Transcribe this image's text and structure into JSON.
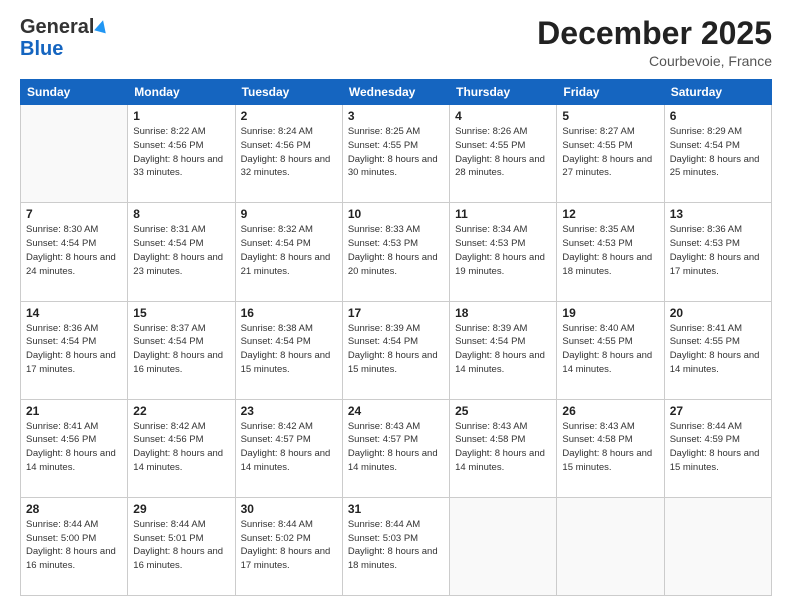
{
  "logo": {
    "general": "General",
    "blue": "Blue"
  },
  "title": "December 2025",
  "subtitle": "Courbevoie, France",
  "days_header": [
    "Sunday",
    "Monday",
    "Tuesday",
    "Wednesday",
    "Thursday",
    "Friday",
    "Saturday"
  ],
  "weeks": [
    [
      {
        "num": "",
        "sunrise": "",
        "sunset": "",
        "daylight": ""
      },
      {
        "num": "1",
        "sunrise": "Sunrise: 8:22 AM",
        "sunset": "Sunset: 4:56 PM",
        "daylight": "Daylight: 8 hours and 33 minutes."
      },
      {
        "num": "2",
        "sunrise": "Sunrise: 8:24 AM",
        "sunset": "Sunset: 4:56 PM",
        "daylight": "Daylight: 8 hours and 32 minutes."
      },
      {
        "num": "3",
        "sunrise": "Sunrise: 8:25 AM",
        "sunset": "Sunset: 4:55 PM",
        "daylight": "Daylight: 8 hours and 30 minutes."
      },
      {
        "num": "4",
        "sunrise": "Sunrise: 8:26 AM",
        "sunset": "Sunset: 4:55 PM",
        "daylight": "Daylight: 8 hours and 28 minutes."
      },
      {
        "num": "5",
        "sunrise": "Sunrise: 8:27 AM",
        "sunset": "Sunset: 4:55 PM",
        "daylight": "Daylight: 8 hours and 27 minutes."
      },
      {
        "num": "6",
        "sunrise": "Sunrise: 8:29 AM",
        "sunset": "Sunset: 4:54 PM",
        "daylight": "Daylight: 8 hours and 25 minutes."
      }
    ],
    [
      {
        "num": "7",
        "sunrise": "Sunrise: 8:30 AM",
        "sunset": "Sunset: 4:54 PM",
        "daylight": "Daylight: 8 hours and 24 minutes."
      },
      {
        "num": "8",
        "sunrise": "Sunrise: 8:31 AM",
        "sunset": "Sunset: 4:54 PM",
        "daylight": "Daylight: 8 hours and 23 minutes."
      },
      {
        "num": "9",
        "sunrise": "Sunrise: 8:32 AM",
        "sunset": "Sunset: 4:54 PM",
        "daylight": "Daylight: 8 hours and 21 minutes."
      },
      {
        "num": "10",
        "sunrise": "Sunrise: 8:33 AM",
        "sunset": "Sunset: 4:53 PM",
        "daylight": "Daylight: 8 hours and 20 minutes."
      },
      {
        "num": "11",
        "sunrise": "Sunrise: 8:34 AM",
        "sunset": "Sunset: 4:53 PM",
        "daylight": "Daylight: 8 hours and 19 minutes."
      },
      {
        "num": "12",
        "sunrise": "Sunrise: 8:35 AM",
        "sunset": "Sunset: 4:53 PM",
        "daylight": "Daylight: 8 hours and 18 minutes."
      },
      {
        "num": "13",
        "sunrise": "Sunrise: 8:36 AM",
        "sunset": "Sunset: 4:53 PM",
        "daylight": "Daylight: 8 hours and 17 minutes."
      }
    ],
    [
      {
        "num": "14",
        "sunrise": "Sunrise: 8:36 AM",
        "sunset": "Sunset: 4:54 PM",
        "daylight": "Daylight: 8 hours and 17 minutes."
      },
      {
        "num": "15",
        "sunrise": "Sunrise: 8:37 AM",
        "sunset": "Sunset: 4:54 PM",
        "daylight": "Daylight: 8 hours and 16 minutes."
      },
      {
        "num": "16",
        "sunrise": "Sunrise: 8:38 AM",
        "sunset": "Sunset: 4:54 PM",
        "daylight": "Daylight: 8 hours and 15 minutes."
      },
      {
        "num": "17",
        "sunrise": "Sunrise: 8:39 AM",
        "sunset": "Sunset: 4:54 PM",
        "daylight": "Daylight: 8 hours and 15 minutes."
      },
      {
        "num": "18",
        "sunrise": "Sunrise: 8:39 AM",
        "sunset": "Sunset: 4:54 PM",
        "daylight": "Daylight: 8 hours and 14 minutes."
      },
      {
        "num": "19",
        "sunrise": "Sunrise: 8:40 AM",
        "sunset": "Sunset: 4:55 PM",
        "daylight": "Daylight: 8 hours and 14 minutes."
      },
      {
        "num": "20",
        "sunrise": "Sunrise: 8:41 AM",
        "sunset": "Sunset: 4:55 PM",
        "daylight": "Daylight: 8 hours and 14 minutes."
      }
    ],
    [
      {
        "num": "21",
        "sunrise": "Sunrise: 8:41 AM",
        "sunset": "Sunset: 4:56 PM",
        "daylight": "Daylight: 8 hours and 14 minutes."
      },
      {
        "num": "22",
        "sunrise": "Sunrise: 8:42 AM",
        "sunset": "Sunset: 4:56 PM",
        "daylight": "Daylight: 8 hours and 14 minutes."
      },
      {
        "num": "23",
        "sunrise": "Sunrise: 8:42 AM",
        "sunset": "Sunset: 4:57 PM",
        "daylight": "Daylight: 8 hours and 14 minutes."
      },
      {
        "num": "24",
        "sunrise": "Sunrise: 8:43 AM",
        "sunset": "Sunset: 4:57 PM",
        "daylight": "Daylight: 8 hours and 14 minutes."
      },
      {
        "num": "25",
        "sunrise": "Sunrise: 8:43 AM",
        "sunset": "Sunset: 4:58 PM",
        "daylight": "Daylight: 8 hours and 14 minutes."
      },
      {
        "num": "26",
        "sunrise": "Sunrise: 8:43 AM",
        "sunset": "Sunset: 4:58 PM",
        "daylight": "Daylight: 8 hours and 15 minutes."
      },
      {
        "num": "27",
        "sunrise": "Sunrise: 8:44 AM",
        "sunset": "Sunset: 4:59 PM",
        "daylight": "Daylight: 8 hours and 15 minutes."
      }
    ],
    [
      {
        "num": "28",
        "sunrise": "Sunrise: 8:44 AM",
        "sunset": "Sunset: 5:00 PM",
        "daylight": "Daylight: 8 hours and 16 minutes."
      },
      {
        "num": "29",
        "sunrise": "Sunrise: 8:44 AM",
        "sunset": "Sunset: 5:01 PM",
        "daylight": "Daylight: 8 hours and 16 minutes."
      },
      {
        "num": "30",
        "sunrise": "Sunrise: 8:44 AM",
        "sunset": "Sunset: 5:02 PM",
        "daylight": "Daylight: 8 hours and 17 minutes."
      },
      {
        "num": "31",
        "sunrise": "Sunrise: 8:44 AM",
        "sunset": "Sunset: 5:03 PM",
        "daylight": "Daylight: 8 hours and 18 minutes."
      },
      {
        "num": "",
        "sunrise": "",
        "sunset": "",
        "daylight": ""
      },
      {
        "num": "",
        "sunrise": "",
        "sunset": "",
        "daylight": ""
      },
      {
        "num": "",
        "sunrise": "",
        "sunset": "",
        "daylight": ""
      }
    ]
  ]
}
